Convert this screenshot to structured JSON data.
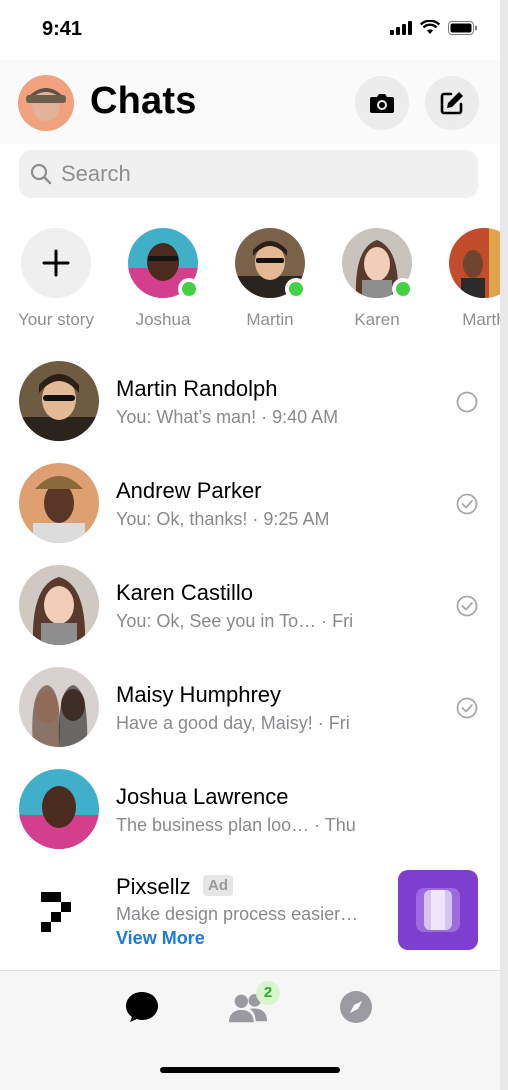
{
  "status_bar": {
    "time": "9:41"
  },
  "header": {
    "title": "Chats"
  },
  "search": {
    "placeholder": "Search"
  },
  "stories": [
    {
      "label": "Your story"
    },
    {
      "label": "Joshua"
    },
    {
      "label": "Martin"
    },
    {
      "label": "Karen"
    },
    {
      "label": "Marth"
    }
  ],
  "chats": [
    {
      "name": "Martin Randolph",
      "preview": "You: What’s man! · 9:40 AM",
      "status": "sent"
    },
    {
      "name": "Andrew Parker",
      "preview": "You: Ok, thanks! · 9:25 AM",
      "status": "delivered"
    },
    {
      "name": "Karen Castillo",
      "preview": "You: Ok, See you in To… · Fri",
      "status": "delivered"
    },
    {
      "name": "Maisy Humphrey",
      "preview": "Have a good day, Maisy! · Fri",
      "status": "delivered"
    },
    {
      "name": "Joshua Lawrence",
      "preview": "The business plan loo… · Thu",
      "status": "none"
    }
  ],
  "ad": {
    "name": "Pixsellz",
    "badge": "Ad",
    "preview": "Make design process easier…",
    "cta": "View More"
  },
  "tabbar": {
    "people_badge": "2"
  },
  "colors": {
    "online": "#45d145",
    "link": "#1a7be0",
    "ad_thumb": "#7e3fcf"
  }
}
